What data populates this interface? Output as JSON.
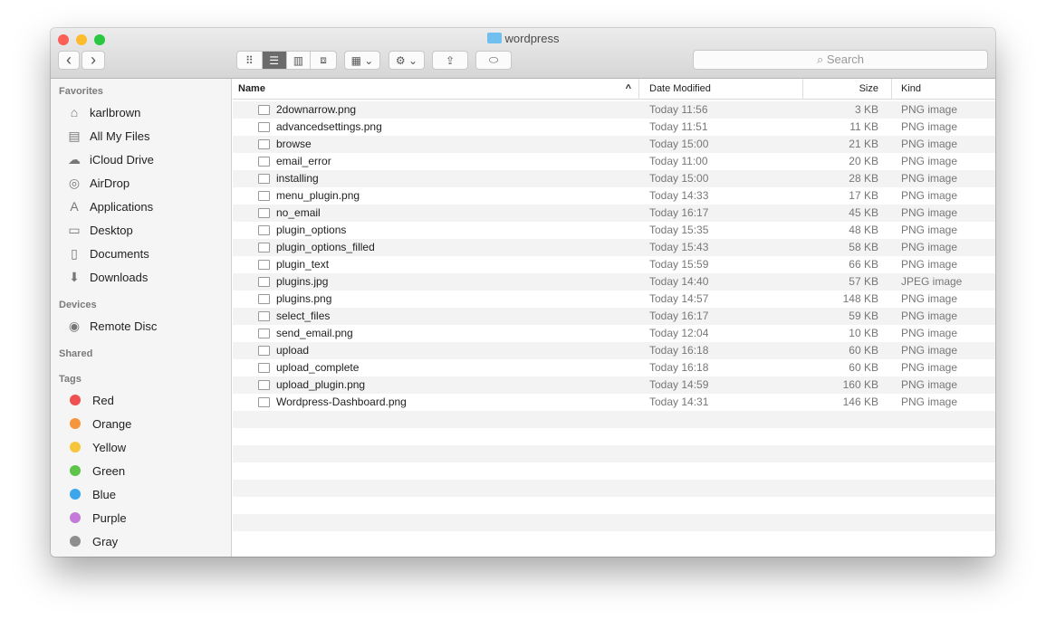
{
  "window": {
    "title": "wordpress",
    "search_placeholder": "Search"
  },
  "toolbar": {
    "back": "‹",
    "forward": "›",
    "view_modes": [
      "icon",
      "list",
      "column",
      "cover-flow"
    ],
    "active_view": "list"
  },
  "sidebar": {
    "favorites_header": "Favorites",
    "favorites": [
      {
        "label": "karlbrown",
        "icon": "home-icon"
      },
      {
        "label": "All My Files",
        "icon": "all-files-icon"
      },
      {
        "label": "iCloud Drive",
        "icon": "cloud-icon"
      },
      {
        "label": "AirDrop",
        "icon": "airdrop-icon"
      },
      {
        "label": "Applications",
        "icon": "applications-icon"
      },
      {
        "label": "Desktop",
        "icon": "desktop-icon"
      },
      {
        "label": "Documents",
        "icon": "documents-icon"
      },
      {
        "label": "Downloads",
        "icon": "downloads-icon"
      }
    ],
    "devices_header": "Devices",
    "devices": [
      {
        "label": "Remote Disc",
        "icon": "disc-icon"
      }
    ],
    "shared_header": "Shared",
    "tags_header": "Tags",
    "tags": [
      {
        "label": "Red",
        "color": "#f0504f"
      },
      {
        "label": "Orange",
        "color": "#f5963c"
      },
      {
        "label": "Yellow",
        "color": "#f5c63c"
      },
      {
        "label": "Green",
        "color": "#5ec54a"
      },
      {
        "label": "Blue",
        "color": "#3ba6ec"
      },
      {
        "label": "Purple",
        "color": "#c57ad9"
      },
      {
        "label": "Gray",
        "color": "#8e8e8e"
      }
    ]
  },
  "columns": {
    "name": "Name",
    "date": "Date Modified",
    "size": "Size",
    "kind": "Kind"
  },
  "files": [
    {
      "name": "2downarrow.png",
      "date": "Today 11:56",
      "size": "3 KB",
      "kind": "PNG image"
    },
    {
      "name": "advancedsettings.png",
      "date": "Today 11:51",
      "size": "11 KB",
      "kind": "PNG image"
    },
    {
      "name": "browse",
      "date": "Today 15:00",
      "size": "21 KB",
      "kind": "PNG image"
    },
    {
      "name": "email_error",
      "date": "Today 11:00",
      "size": "20 KB",
      "kind": "PNG image"
    },
    {
      "name": "installing",
      "date": "Today 15:00",
      "size": "28 KB",
      "kind": "PNG image"
    },
    {
      "name": "menu_plugin.png",
      "date": "Today 14:33",
      "size": "17 KB",
      "kind": "PNG image"
    },
    {
      "name": "no_email",
      "date": "Today 16:17",
      "size": "45 KB",
      "kind": "PNG image"
    },
    {
      "name": "plugin_options",
      "date": "Today 15:35",
      "size": "48 KB",
      "kind": "PNG image"
    },
    {
      "name": "plugin_options_filled",
      "date": "Today 15:43",
      "size": "58 KB",
      "kind": "PNG image"
    },
    {
      "name": "plugin_text",
      "date": "Today 15:59",
      "size": "66 KB",
      "kind": "PNG image"
    },
    {
      "name": "plugins.jpg",
      "date": "Today 14:40",
      "size": "57 KB",
      "kind": "JPEG image"
    },
    {
      "name": "plugins.png",
      "date": "Today 14:57",
      "size": "148 KB",
      "kind": "PNG image"
    },
    {
      "name": "select_files",
      "date": "Today 16:17",
      "size": "59 KB",
      "kind": "PNG image"
    },
    {
      "name": "send_email.png",
      "date": "Today 12:04",
      "size": "10 KB",
      "kind": "PNG image"
    },
    {
      "name": "upload",
      "date": "Today 16:18",
      "size": "60 KB",
      "kind": "PNG image"
    },
    {
      "name": "upload_complete",
      "date": "Today 16:18",
      "size": "60 KB",
      "kind": "PNG image"
    },
    {
      "name": "upload_plugin.png",
      "date": "Today 14:59",
      "size": "160 KB",
      "kind": "PNG image"
    },
    {
      "name": "Wordpress-Dashboard.png",
      "date": "Today 14:31",
      "size": "146 KB",
      "kind": "PNG image"
    }
  ]
}
